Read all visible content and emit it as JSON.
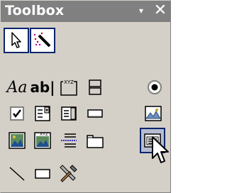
{
  "window": {
    "title": "Toolbox",
    "menu_glyph": "▾",
    "close_glyph": "✕"
  },
  "tools": [
    {
      "id": "pointer",
      "icon": "pointer-icon",
      "state": "selected"
    },
    {
      "id": "control-wizards",
      "icon": "magic-wand-icon",
      "state": "selected"
    },
    {
      "id": "label",
      "icon": "label-icon",
      "text": "Aa"
    },
    {
      "id": "text-box",
      "icon": "text-box-icon",
      "text": "ab|"
    },
    {
      "id": "option-group",
      "icon": "option-group-icon",
      "text": "XYZ"
    },
    {
      "id": "toggle-button",
      "icon": "toggle-button-icon"
    },
    {
      "id": "option-button",
      "icon": "option-button-icon"
    },
    {
      "id": "check-box",
      "icon": "check-box-icon"
    },
    {
      "id": "combo-box",
      "icon": "combo-box-icon"
    },
    {
      "id": "list-box",
      "icon": "list-box-icon"
    },
    {
      "id": "command-button",
      "icon": "command-button-icon"
    },
    {
      "id": "image",
      "icon": "image-icon"
    },
    {
      "id": "unbound-object-frame",
      "icon": "unbound-object-frame-icon"
    },
    {
      "id": "bound-object-frame",
      "icon": "bound-object-frame-icon",
      "text": "XYZ"
    },
    {
      "id": "page-break",
      "icon": "page-break-icon"
    },
    {
      "id": "tab-control",
      "icon": "tab-control-icon"
    },
    {
      "id": "subform",
      "icon": "subform-icon",
      "state": "hover"
    },
    {
      "id": "line",
      "icon": "line-icon"
    },
    {
      "id": "rectangle",
      "icon": "rectangle-icon"
    },
    {
      "id": "more-controls",
      "icon": "more-controls-icon"
    }
  ],
  "colors": {
    "titlebar": "#808080",
    "panel": "#d4d0c8",
    "selection_border": "#0a246a"
  }
}
